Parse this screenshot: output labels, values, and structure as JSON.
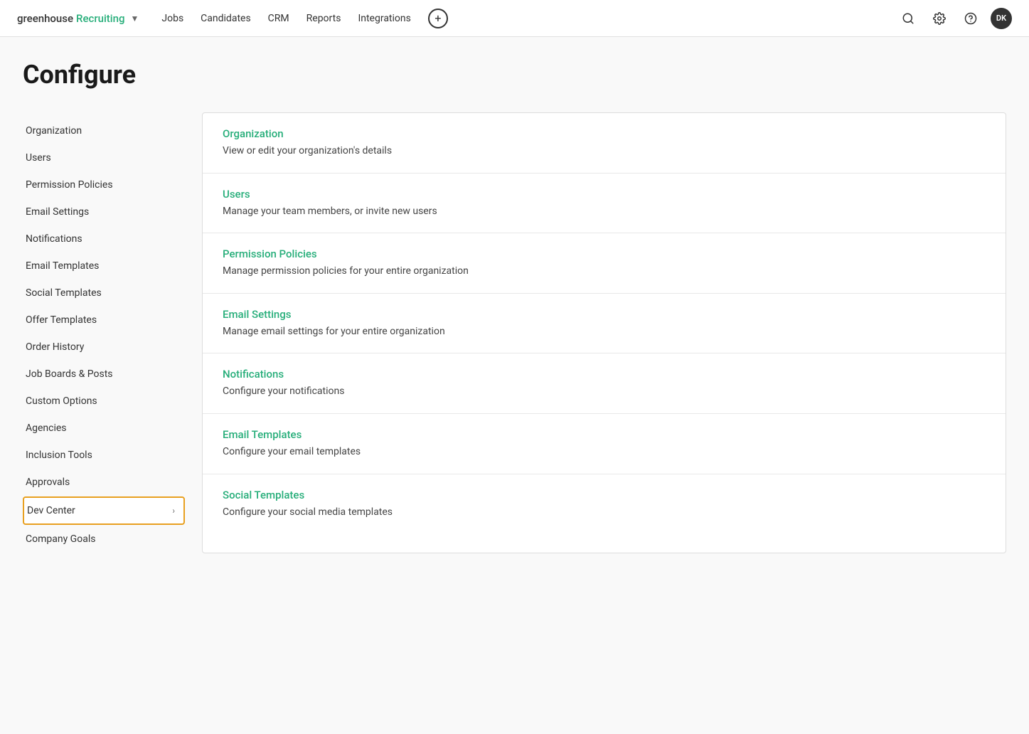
{
  "nav": {
    "brand_gh": "greenhouse",
    "brand_recruiting": "Recruiting",
    "links": [
      "Jobs",
      "Candidates",
      "CRM",
      "Reports",
      "Integrations"
    ],
    "add_button": "+",
    "avatar_initials": "DK"
  },
  "page": {
    "title": "Configure"
  },
  "sidebar": {
    "items": [
      {
        "label": "Organization",
        "active": false,
        "has_chevron": false
      },
      {
        "label": "Users",
        "active": false,
        "has_chevron": false
      },
      {
        "label": "Permission Policies",
        "active": false,
        "has_chevron": false
      },
      {
        "label": "Email Settings",
        "active": false,
        "has_chevron": false
      },
      {
        "label": "Notifications",
        "active": false,
        "has_chevron": false
      },
      {
        "label": "Email Templates",
        "active": false,
        "has_chevron": false
      },
      {
        "label": "Social Templates",
        "active": false,
        "has_chevron": false
      },
      {
        "label": "Offer Templates",
        "active": false,
        "has_chevron": false
      },
      {
        "label": "Order History",
        "active": false,
        "has_chevron": false
      },
      {
        "label": "Job Boards & Posts",
        "active": false,
        "has_chevron": false
      },
      {
        "label": "Custom Options",
        "active": false,
        "has_chevron": false
      },
      {
        "label": "Agencies",
        "active": false,
        "has_chevron": false
      },
      {
        "label": "Inclusion Tools",
        "active": false,
        "has_chevron": false
      },
      {
        "label": "Approvals",
        "active": false,
        "has_chevron": false
      },
      {
        "label": "Dev Center",
        "active": true,
        "has_chevron": true
      },
      {
        "label": "Company Goals",
        "active": false,
        "has_chevron": false
      }
    ]
  },
  "content": {
    "items": [
      {
        "title": "Organization",
        "description": "View or edit your organization's details"
      },
      {
        "title": "Users",
        "description": "Manage your team members, or invite new users"
      },
      {
        "title": "Permission Policies",
        "description": "Manage permission policies for your entire organization"
      },
      {
        "title": "Email Settings",
        "description": "Manage email settings for your entire organization"
      },
      {
        "title": "Notifications",
        "description": "Configure your notifications"
      },
      {
        "title": "Email Templates",
        "description": "Configure your email templates"
      },
      {
        "title": "Social Templates",
        "description": "Configure your social media templates"
      }
    ]
  }
}
